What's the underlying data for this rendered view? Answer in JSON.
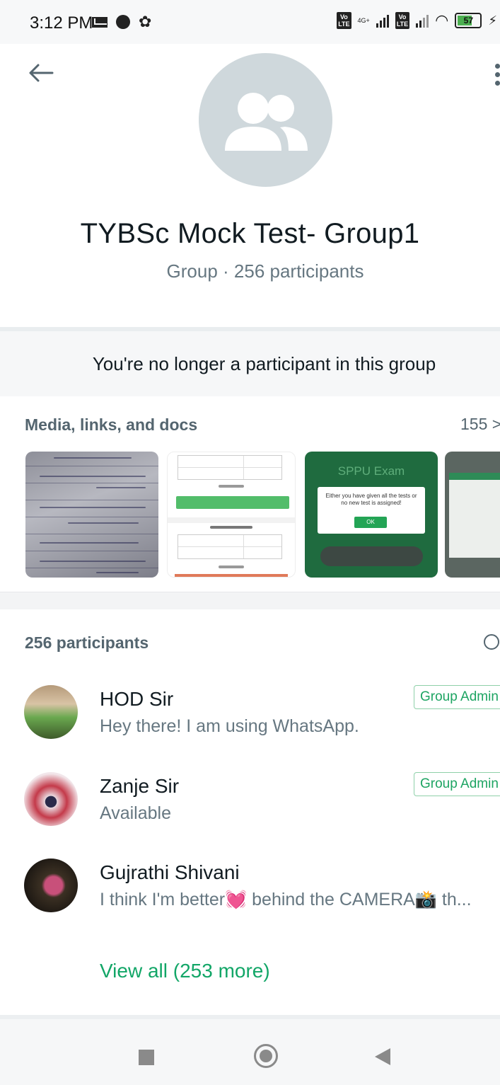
{
  "status_bar": {
    "time": "3:12 PM",
    "battery": "57",
    "network_label": "4G+",
    "icons": [
      "mail-icon",
      "notification-circle-icon",
      "gear-icon",
      "volte-icon",
      "signal-icon",
      "wifi-icon",
      "battery-icon",
      "charging-icon"
    ]
  },
  "header": {
    "back_icon": "back-arrow-icon",
    "menu_icon": "more-vertical-icon"
  },
  "group": {
    "title": "TYBSc Mock Test- Group1",
    "subtitle": "Group · 256 participants",
    "avatar_icon": "group-people-icon",
    "avatar_color": "#cfd8dc"
  },
  "notice": {
    "text": "You're no longer a participant in this group"
  },
  "media": {
    "title": "Media, links, and docs",
    "count": "155 >",
    "thumbnails": [
      {
        "name": "handwritten-notes-photo"
      },
      {
        "name": "mock-test-screenshot"
      },
      {
        "name": "sppu-exam-screenshot",
        "title": "SPPU Exam",
        "message": "Either you have given all the tests or no new test is assigned!",
        "button": "OK"
      },
      {
        "name": "partial-screenshot"
      }
    ]
  },
  "participants": {
    "header": "256 participants",
    "search_icon": "search-icon",
    "list": [
      {
        "name": "HOD Sir",
        "status": "Hey there! I am using WhatsApp.",
        "badge": "Group Admin"
      },
      {
        "name": "Zanje Sir",
        "status": "Available",
        "badge": "Group Admin"
      },
      {
        "name": "Gujrathi Shivani",
        "status": "I think I'm better💓 behind the CAMERA📸 th...",
        "badge": ""
      }
    ],
    "view_all": "View all (253 more)"
  },
  "colors": {
    "accent": "#12a667",
    "admin_border": "#8fd0a9",
    "muted_text": "#667781",
    "header_text": "#54656f"
  }
}
